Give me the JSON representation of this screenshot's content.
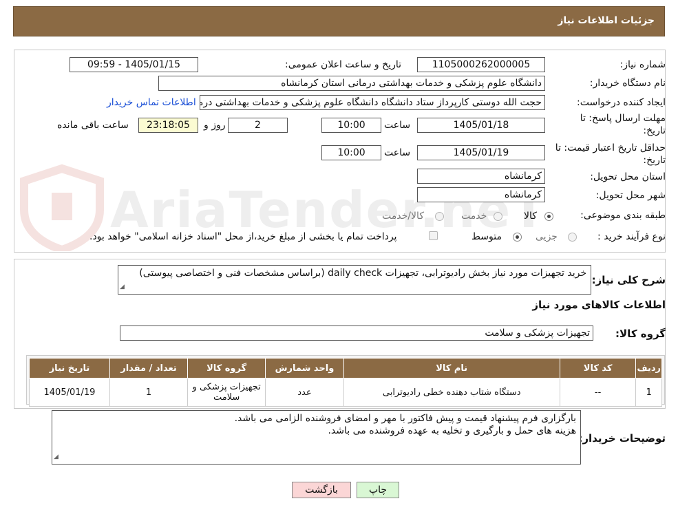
{
  "header": {
    "title": "جزئیات اطلاعات نیاز"
  },
  "form": {
    "need_number_label": "شماره نیاز:",
    "need_number": "1105000262000005",
    "announce_label": "تاریخ و ساعت اعلان عمومی:",
    "announce_value": "1405/01/15 - 09:59",
    "buyer_org_label": "نام دستگاه خریدار:",
    "buyer_org": "دانشگاه علوم پزشکی و خدمات بهداشتی  درمانی استان کرمانشاه",
    "creator_label": "ایجاد کننده درخواست:",
    "creator": "حجت الله دوستی  کارپرداز ستاد دانشگاه دانشگاه علوم پزشکی و خدمات بهداشتی  درمانی",
    "contact_link": "اطلاعات تماس خریدار",
    "deadline_label_1": "مهلت ارسال پاسخ: تا",
    "deadline_label_2": "تاریخ:",
    "deadline_date": "1405/01/18",
    "time_label": "ساعت",
    "deadline_time": "10:00",
    "days_value": "2",
    "days_label": "روز و",
    "remaining_time": "23:18:05",
    "remaining_label": "ساعت باقی مانده",
    "validity_label_1": "حداقل تاریخ اعتبار قیمت: تا",
    "validity_label_2": "تاریخ:",
    "validity_date": "1405/01/19",
    "validity_time": "10:00",
    "province_label": "استان محل تحویل:",
    "province": "کرمانشاه",
    "city_label": "شهر محل تحویل:",
    "city": "کرمانشاه",
    "category_label": "طبقه بندی موضوعی:",
    "category_options": [
      "کالا",
      "خدمت",
      "کالا/خدمت"
    ],
    "category_selected": "کالا",
    "process_label": "نوع فرآیند خرید :",
    "process_options": [
      "جزیی",
      "متوسط"
    ],
    "process_selected": "متوسط",
    "payment_note": "پرداخت تمام یا بخشی از مبلغ خرید،از محل \"اسناد خزانه اسلامی\" خواهد بود."
  },
  "description": {
    "label": "شرح کلی نیاز:",
    "text": "خرید تجهیزات مورد نیاز بخش رادیوترابی، تجهیزات daily check  (براساس مشخصات فنی و اختصاصی پیوستی)"
  },
  "goods": {
    "section_title": "اطلاعات کالاهای مورد نیاز",
    "group_label": "گروه کالا:",
    "group_value": "تجهیزات پزشکی و سلامت",
    "columns": [
      "ردیف",
      "کد کالا",
      "نام کالا",
      "واحد شمارش",
      "گروه کالا",
      "تعداد / مقدار",
      "تاریخ نیاز"
    ],
    "rows": [
      {
        "row": "1",
        "code": "--",
        "name": "دستگاه شتاب دهنده خطی رادیوترابی",
        "unit": "عدد",
        "group": "تجهیزات پزشکی و سلامت",
        "qty": "1",
        "date": "1405/01/19"
      }
    ]
  },
  "buyer_notes": {
    "label": "توضیحات خریدار:",
    "line1": "بارگزاری فرم پیشنهاد قیمت و پیش فاکتور با مهر و امضای فروشنده الزامی می باشد.",
    "line2": "هزینه های حمل و بارگیری و تخلیه به عهده فروشنده می باشد."
  },
  "buttons": {
    "print": "چاپ",
    "back": "بازگشت"
  },
  "watermark_text": "AriaTender.neT",
  "colors": {
    "header": "#8b6a44",
    "link": "#1a4fd6",
    "print_button": "#d9f7d4",
    "back_button": "#fbd6d6"
  }
}
